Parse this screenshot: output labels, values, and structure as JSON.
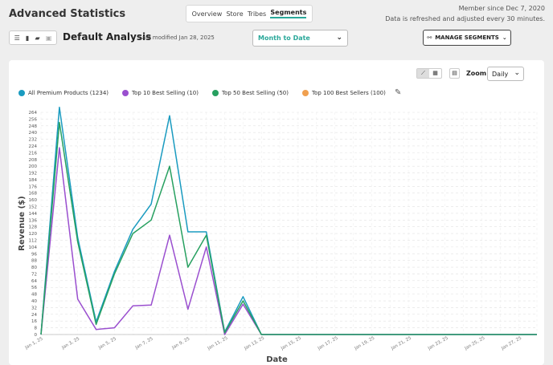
{
  "header": {
    "title": "Advanced Statistics",
    "member_since": "Member since Dec 7, 2020",
    "refresh_note": "Data is refreshed and adjusted every 30 minutes."
  },
  "nav": {
    "tabs": [
      {
        "label": "Overview"
      },
      {
        "label": "Store"
      },
      {
        "label": "Tribes"
      },
      {
        "label": "Segments"
      }
    ],
    "active": "Segments"
  },
  "toolbar": {
    "icons": [
      "menu-icon",
      "file-icon",
      "folder-icon",
      "save-icon"
    ]
  },
  "analysis": {
    "name": "Default Analysis",
    "modified": "Last modified Jan 28, 2025"
  },
  "date_range": {
    "value": "Month to Date"
  },
  "segments_button": {
    "label": "MANAGE SEGMENTS"
  },
  "zoom": {
    "label": "Zoom",
    "value": "Daily"
  },
  "legend": [
    {
      "label": "All Premium Products (1234)",
      "color": "#1a9bc0"
    },
    {
      "label": "Top 10 Best Selling (10)",
      "color": "#9a4fcf"
    },
    {
      "label": "Top 50 Best Selling (50)",
      "color": "#27a060"
    },
    {
      "label": "Top 100 Best Sellers (100)",
      "color": "#f0a050"
    }
  ],
  "chart_data": {
    "type": "line",
    "xlabel": "Date",
    "ylabel": "Revenue ($)",
    "ylim": [
      0,
      264
    ],
    "yticks": [
      0,
      8,
      16,
      24,
      32,
      40,
      48,
      56,
      64,
      72,
      80,
      88,
      96,
      104,
      112,
      120,
      128,
      136,
      144,
      152,
      160,
      168,
      176,
      184,
      192,
      200,
      208,
      216,
      224,
      232,
      240,
      248,
      256,
      264
    ],
    "x": [
      "Jan 1, 25",
      "Jan 2, 25",
      "Jan 3, 25",
      "Jan 4, 25",
      "Jan 5, 25",
      "Jan 6, 25",
      "Jan 7, 25",
      "Jan 8, 25",
      "Jan 9, 25",
      "Jan 10, 25",
      "Jan 11, 25",
      "Jan 12, 25",
      "Jan 13, 25",
      "Jan 14, 25",
      "Jan 15, 25",
      "Jan 16, 25",
      "Jan 17, 25",
      "Jan 18, 25",
      "Jan 19, 25",
      "Jan 20, 25",
      "Jan 21, 25",
      "Jan 22, 25",
      "Jan 23, 25",
      "Jan 24, 25",
      "Jan 25, 25",
      "Jan 26, 25",
      "Jan 27, 25",
      "Jan 28, 25"
    ],
    "xtick_labels": [
      "Jan 1, 25",
      "Jan 3, 25",
      "Jan 5, 25",
      "Jan 7, 25",
      "Jan 9, 25",
      "Jan 11, 25",
      "Jan 13, 25",
      "Jan 15, 25",
      "Jan 17, 25",
      "Jan 19, 25",
      "Jan 21, 25",
      "Jan 23, 25",
      "Jan 25, 25",
      "Jan 27, 25"
    ],
    "series": [
      {
        "name": "All Premium Products (1234)",
        "color": "#1a9bc0",
        "values": [
          0,
          270,
          115,
          15,
          75,
          125,
          155,
          260,
          122,
          122,
          3,
          45,
          0,
          0,
          0,
          0,
          0,
          0,
          0,
          0,
          0,
          0,
          0,
          0,
          0,
          0,
          0,
          0
        ]
      },
      {
        "name": "Top 10 Best Selling (10)",
        "color": "#9a4fcf",
        "values": [
          0,
          222,
          42,
          6,
          8,
          34,
          35,
          118,
          30,
          104,
          0,
          36,
          0,
          0,
          0,
          0,
          0,
          0,
          0,
          0,
          0,
          0,
          0,
          0,
          0,
          0,
          0,
          0
        ]
      },
      {
        "name": "Top 50 Best Selling (50)",
        "color": "#27a060",
        "values": [
          0,
          252,
          110,
          12,
          72,
          120,
          136,
          200,
          80,
          118,
          2,
          40,
          0,
          0,
          0,
          0,
          0,
          0,
          0,
          0,
          0,
          0,
          0,
          0,
          0,
          0,
          0,
          0
        ]
      }
    ]
  }
}
